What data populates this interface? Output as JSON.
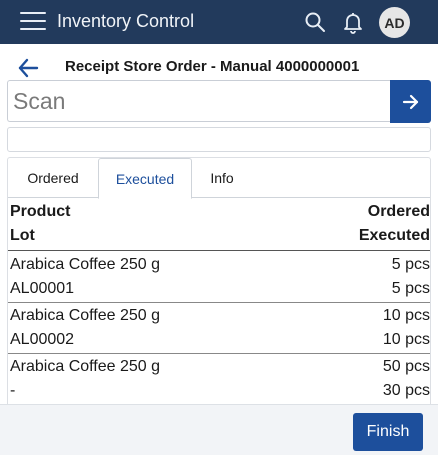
{
  "appbar": {
    "title": "Inventory Control",
    "avatar_initials": "AD",
    "icons": [
      "menu-icon",
      "search-icon",
      "bell-icon"
    ]
  },
  "order": {
    "title": "Receipt Store Order - Manual 4000000001"
  },
  "scan": {
    "placeholder": "Scan",
    "value": ""
  },
  "tabs": [
    {
      "label": "Ordered"
    },
    {
      "label": "Executed",
      "active": true
    },
    {
      "label": "Info"
    }
  ],
  "table": {
    "headers": {
      "product": "Product",
      "lot": "Lot",
      "ordered": "Ordered",
      "executed": "Executed"
    },
    "rows": [
      {
        "product": "Arabica Coffee 250 g",
        "lot": "AL00001",
        "ordered": "5 pcs",
        "executed": "5 pcs"
      },
      {
        "product": "Arabica Coffee 250 g",
        "lot": "AL00002",
        "ordered": "10 pcs",
        "executed": "10 pcs"
      },
      {
        "product": "Arabica Coffee 250 g",
        "lot": "-",
        "ordered": "50 pcs",
        "executed": "30 pcs"
      }
    ]
  },
  "footer": {
    "finish_label": "Finish"
  },
  "colors": {
    "appbar": "#223a5c",
    "primary": "#1d4f9c",
    "footer": "#f2f4f7"
  }
}
